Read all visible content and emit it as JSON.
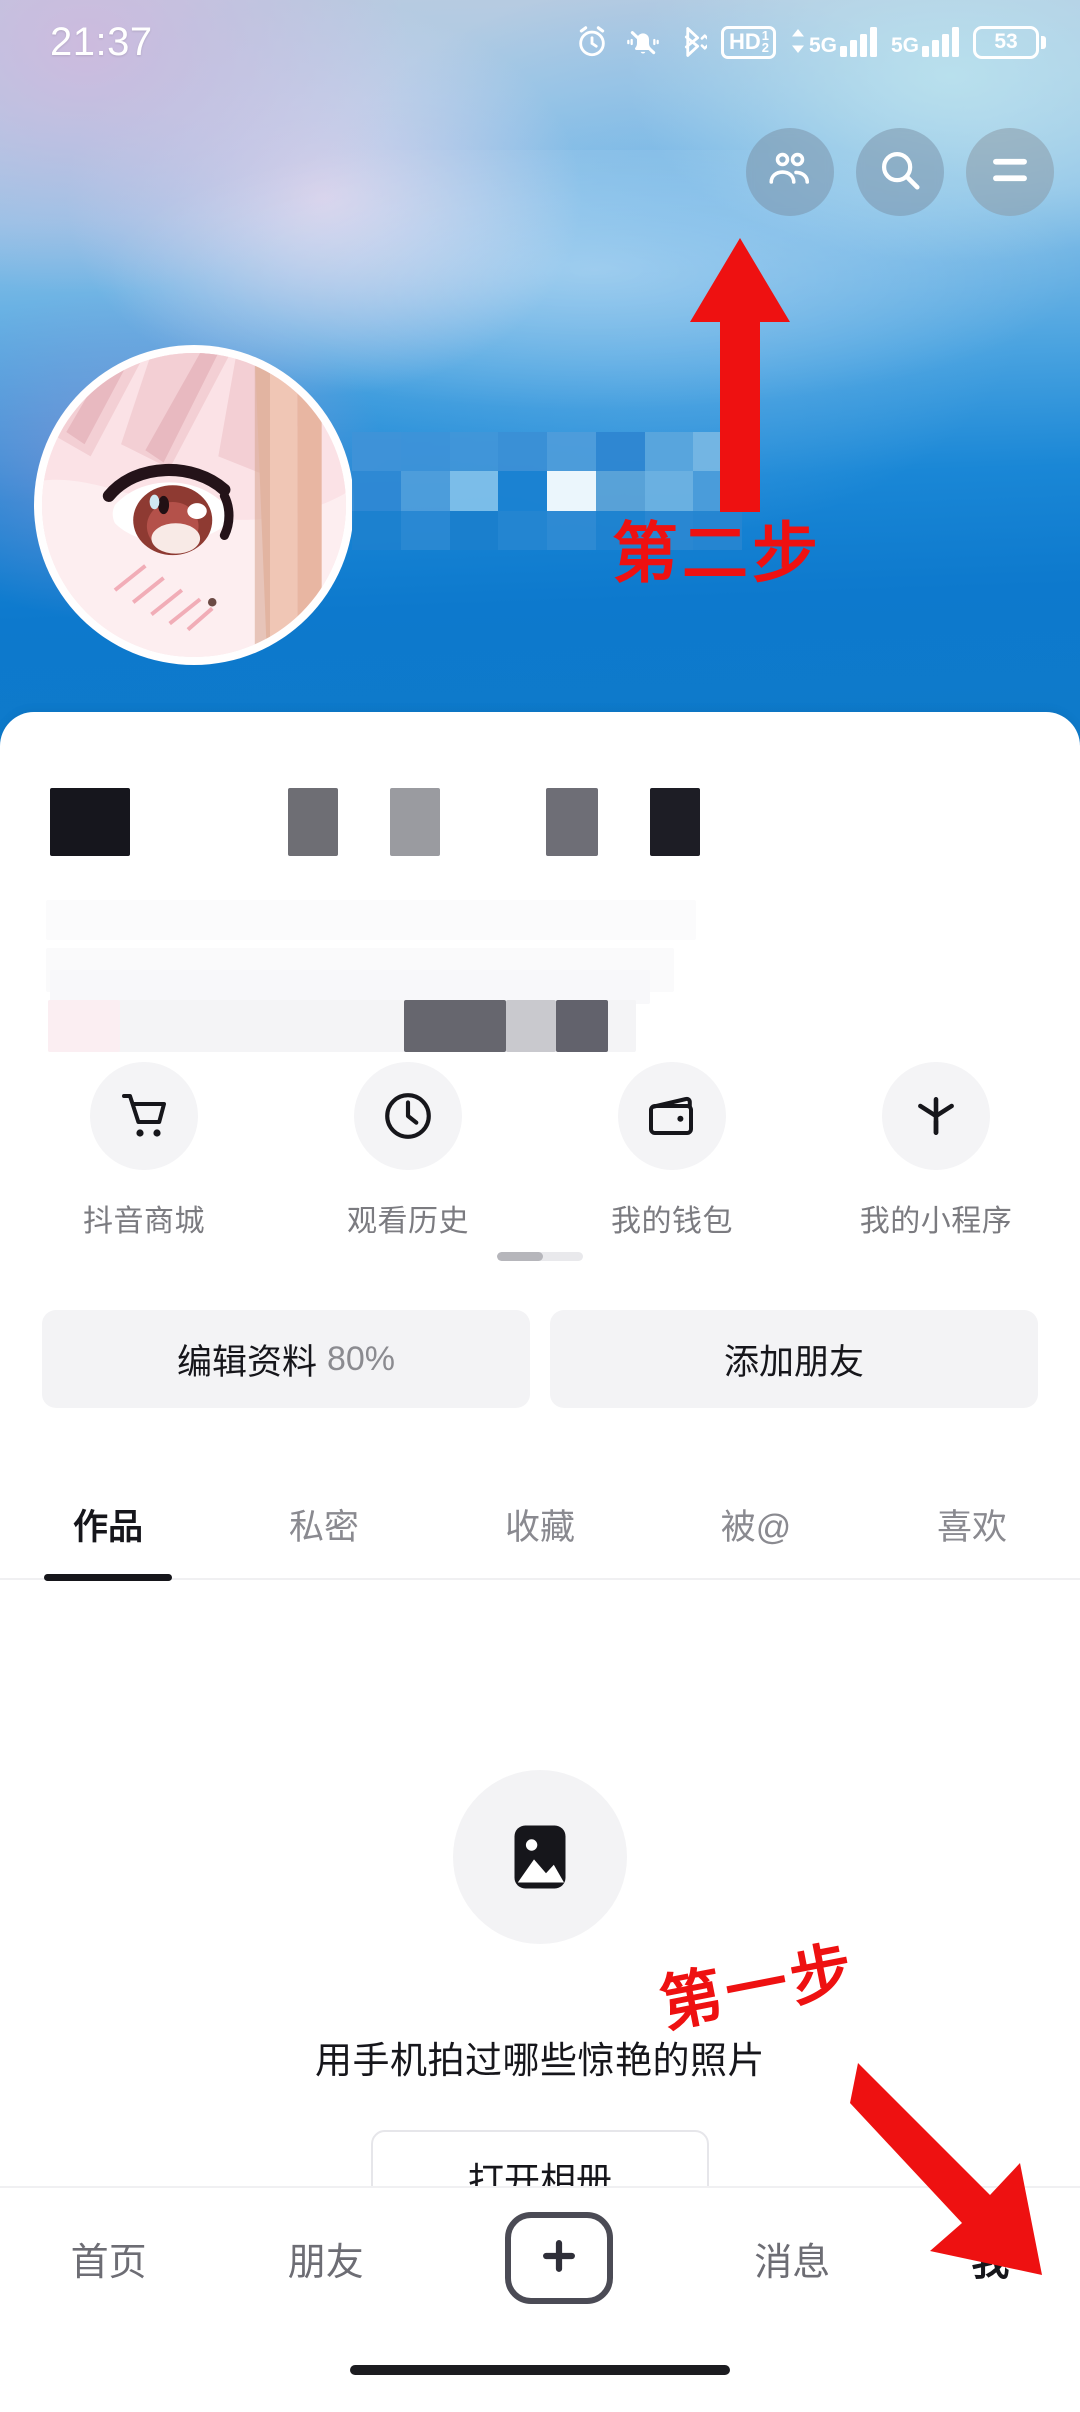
{
  "status_bar": {
    "time": "21:37",
    "icons": [
      "alarm-clock-icon",
      "bell-muted-icon",
      "bluetooth-icon",
      "hd-volte-icon",
      "signal-5g-icon",
      "signal-5g-icon"
    ],
    "hd_label": "HD",
    "hd_sim_top": "1",
    "hd_sim_bottom": "2",
    "net_label_1": "5G",
    "net_label_2": "5G",
    "battery_percent": "53"
  },
  "header": {
    "buttons": [
      {
        "name": "friends-button",
        "icon": "people-icon"
      },
      {
        "name": "search-button",
        "icon": "search-icon"
      },
      {
        "name": "menu-button",
        "icon": "hamburger-menu-icon"
      }
    ],
    "avatar_alt": "anime-avatar",
    "censored_region": "mosaic-redacted-username"
  },
  "profile_info": {
    "redacted": true,
    "note": "username, id and bio are pixelated / blurred out"
  },
  "quick_actions": [
    {
      "label": "抖音商城",
      "icon": "shopping-cart-icon"
    },
    {
      "label": "观看历史",
      "icon": "clock-icon"
    },
    {
      "label": "我的钱包",
      "icon": "wallet-icon"
    },
    {
      "label": "我的小程序",
      "icon": "asterisk-icon"
    }
  ],
  "action_buttons": {
    "edit_profile": "编辑资料",
    "edit_profile_percent": "80%",
    "add_friend": "添加朋友"
  },
  "tabs": [
    {
      "label": "作品",
      "active": true
    },
    {
      "label": "私密",
      "active": false
    },
    {
      "label": "收藏",
      "active": false
    },
    {
      "label": "被@",
      "active": false
    },
    {
      "label": "喜欢",
      "active": false
    }
  ],
  "empty_state": {
    "icon": "image-placeholder-icon",
    "text": "用手机拍过哪些惊艳的照片",
    "button": "打开相册"
  },
  "bottom_nav": [
    {
      "label": "首页",
      "active": false
    },
    {
      "label": "朋友",
      "active": false
    },
    {
      "label": "+",
      "active": false,
      "icon": "plus-icon"
    },
    {
      "label": "消息",
      "active": false
    },
    {
      "label": "我",
      "active": true
    }
  ],
  "annotations": [
    {
      "text": "第二步",
      "color": "#ee1111",
      "points_to": "friends-button"
    },
    {
      "text": "第一步",
      "color": "#ee1111",
      "points_to": "nav-item-me"
    }
  ],
  "colors": {
    "accent_red": "#ee1111",
    "cover_blue": "#0e7ac9",
    "text_dark": "#16161b",
    "text_muted": "#8a8a90",
    "chip_bg": "#f3f3f5"
  }
}
